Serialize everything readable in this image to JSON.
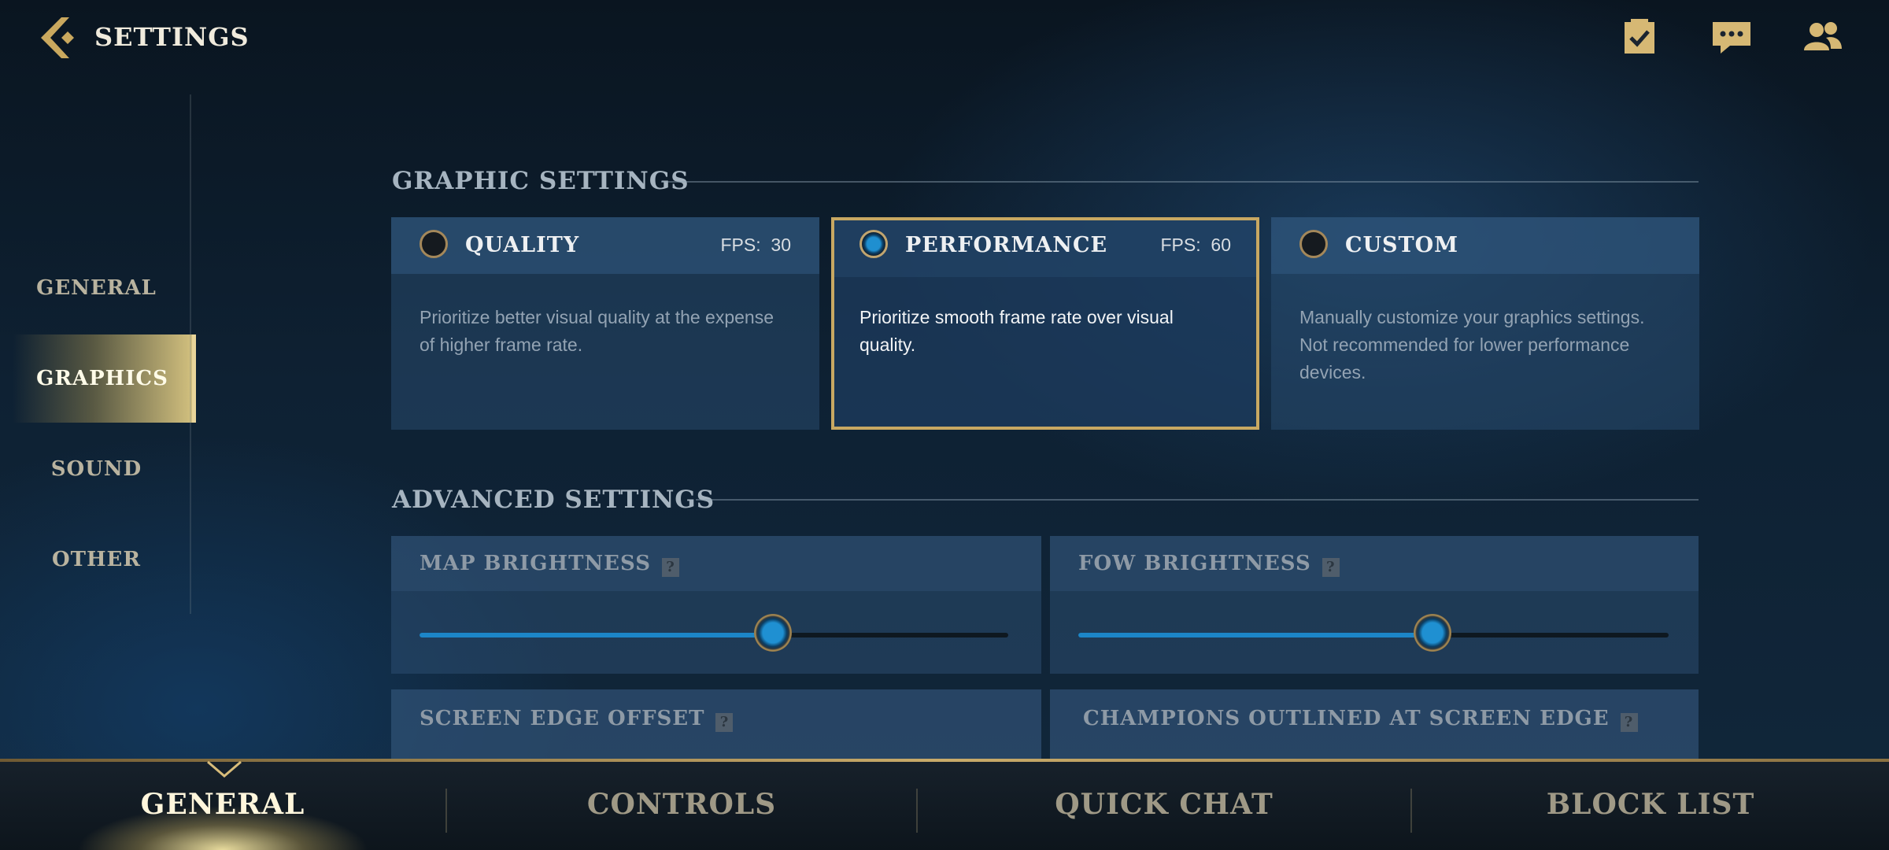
{
  "header": {
    "title": "SETTINGS"
  },
  "icons": {
    "back": "back-arrow-icon",
    "missions": "clipboard-check-icon",
    "chat": "chat-bubble-icon",
    "friends": "friends-icon"
  },
  "sidebar": {
    "items": [
      {
        "label": "GENERAL"
      },
      {
        "label": "GRAPHICS",
        "active": true
      },
      {
        "label": "SOUND"
      },
      {
        "label": "OTHER"
      }
    ]
  },
  "graphic_settings": {
    "title": "GRAPHIC SETTINGS",
    "presets": [
      {
        "name": "QUALITY",
        "fps_label": "FPS:",
        "fps": "30",
        "description": "Prioritize better visual quality at the expense of higher frame rate.",
        "selected": false
      },
      {
        "name": "PERFORMANCE",
        "fps_label": "FPS:",
        "fps": "60",
        "description": "Prioritize smooth frame rate over visual quality.",
        "selected": true
      },
      {
        "name": "CUSTOM",
        "fps_label": "",
        "fps": "",
        "description": "Manually customize your graphics settings. Not recommended for lower performance devices.",
        "selected": false
      }
    ]
  },
  "advanced_settings": {
    "title": "ADVANCED SETTINGS",
    "map_brightness": {
      "label": "MAP BRIGHTNESS",
      "value_fraction": 0.6
    },
    "fow_brightness": {
      "label": "FOW BRIGHTNESS",
      "value_fraction": 0.6
    },
    "screen_edge_offset": {
      "label": "SCREEN EDGE OFFSET"
    },
    "champions_outlined": {
      "label": "CHAMPIONS OUTLINED AT SCREEN EDGE"
    },
    "help_glyph": "?"
  },
  "bottom_tabs": [
    {
      "label": "GENERAL",
      "active": true
    },
    {
      "label": "CONTROLS"
    },
    {
      "label": "QUICK CHAT"
    },
    {
      "label": "BLOCK LIST"
    }
  ],
  "colors": {
    "accent_gold": "#c8a862",
    "slider_blue": "#1c86c8"
  }
}
